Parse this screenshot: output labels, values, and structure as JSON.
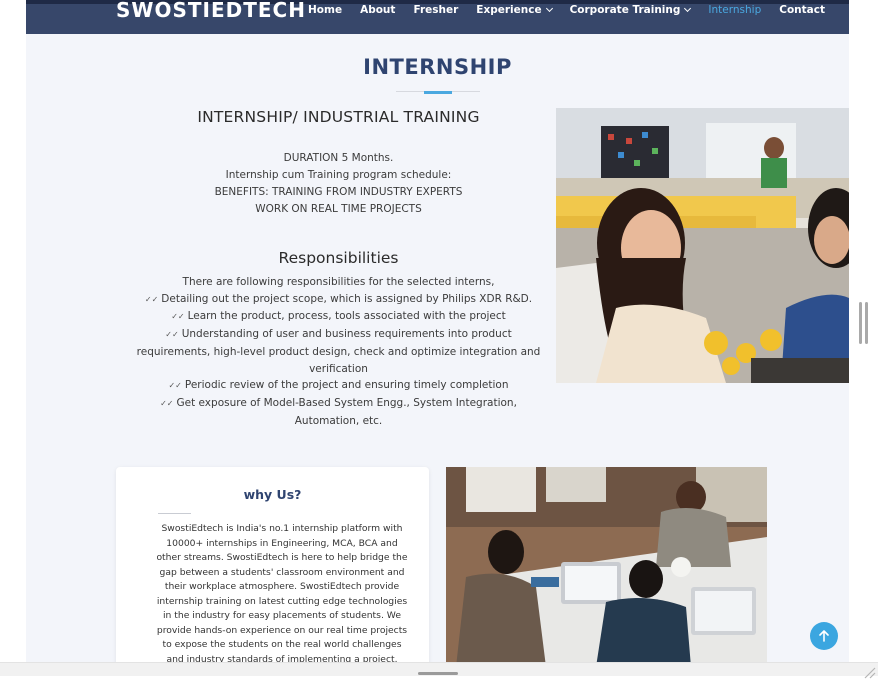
{
  "brand": "SWOSTIEDTECH",
  "nav": {
    "home": "Home",
    "about": "About",
    "fresher": "Fresher",
    "experience": "Experience",
    "corporate": "Corporate Training",
    "internship": "Internship",
    "contact": "Contact"
  },
  "page": {
    "title": "INTERNSHIP",
    "section_heading": "INTERNSHIP/ INDUSTRIAL TRAINING",
    "details": [
      "DURATION 5 Months.",
      "Internship cum Training program schedule:",
      "BENEFITS: TRAINING FROM INDUSTRY EXPERTS",
      "WORK ON REAL TIME PROJECTS"
    ],
    "responsibilities_heading": "Responsibilities",
    "responsibilities_intro": "There are following responsibilities for the selected interns,",
    "responsibilities": [
      "Detailing out the project scope, which is assigned by Philips XDR R&D.",
      "Learn the product, process, tools associated with the project",
      "Understanding of user and business requirements into product requirements, high-level product design, check and optimize integration and verification",
      "Periodic review of the project and ensuring timely completion",
      "Get exposure of Model-Based System Engg., System Integration, Automation, etc."
    ]
  },
  "why_us": {
    "title": "why Us?",
    "text": "SwostiEdtech is India's no.1 internship platform with 10000+ internships in Engineering, MCA, BCA and other streams. SwostiEdtech is here to help bridge the gap between a students' classroom environment and their workplace atmosphere. SwostiEdtech provide internship training on latest cutting edge technologies in the industry for easy placements of students. We provide hands-on experience on our real time projects to expose the students on the real world challenges and industry standards of implementing a project."
  },
  "icons": {
    "scroll_top": "arrow-up-icon",
    "dropdown": "chevron-down-icon",
    "bullet": "double-check-icon"
  },
  "colors": {
    "navbar": "#37476a",
    "accent": "#4aa8e0",
    "heading": "#2f4470",
    "background": "#f3f5fa"
  }
}
